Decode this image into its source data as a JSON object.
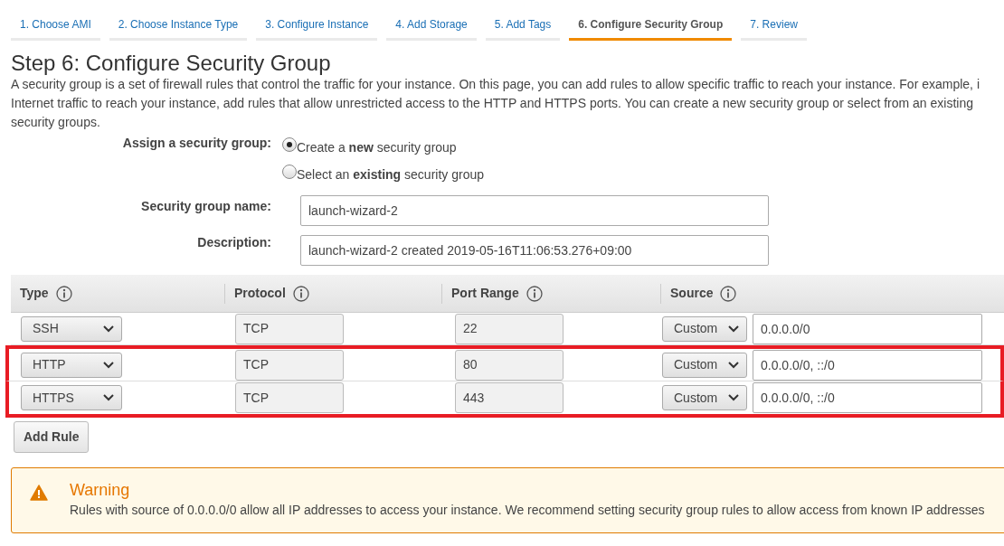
{
  "tabs": [
    {
      "label": "1. Choose AMI",
      "selected": false
    },
    {
      "label": "2. Choose Instance Type",
      "selected": false
    },
    {
      "label": "3. Configure Instance",
      "selected": false
    },
    {
      "label": "4. Add Storage",
      "selected": false
    },
    {
      "label": "5. Add Tags",
      "selected": false
    },
    {
      "label": "6. Configure Security Group",
      "selected": true
    },
    {
      "label": "7. Review",
      "selected": false
    }
  ],
  "title": "Step 6: Configure Security Group",
  "intro": "A security group is a set of firewall rules that control the traffic for your instance. On this page, you can add rules to allow specific traffic to reach your instance. For example, i",
  "intro_2": "Internet traffic to reach your instance, add rules that allow unrestricted access to the HTTP and HTTPS ports. You can create a new security group or select from an existing",
  "intro_3": "security groups.",
  "assign": {
    "label": "Assign a security group:",
    "options": [
      {
        "label": "Create a **new** security group",
        "selected": true
      },
      {
        "label": "Select an **existing** security group",
        "selected": false
      }
    ]
  },
  "fields": [
    {
      "label": "Security group name:",
      "value": "launch-wizard-2"
    },
    {
      "label": "Description:",
      "value": "launch-wizard-2 created 2019-05-16T11:06:53.276+09:00"
    }
  ],
  "table": {
    "columns": [
      "Type",
      "Protocol",
      "Port Range",
      "Source"
    ],
    "rows": [
      {
        "type": "SSH",
        "protocol": "TCP",
        "port_range": "22",
        "source": "Custom",
        "cidr": "0.0.0.0/0",
        "highlighted": false
      },
      {
        "type": "HTTP",
        "protocol": "TCP",
        "port_range": "80",
        "source": "Custom",
        "cidr": "0.0.0.0/0, ::/0",
        "highlighted": true
      },
      {
        "type": "HTTPS",
        "protocol": "TCP",
        "port_range": "443",
        "source": "Custom",
        "cidr": "0.0.0.0/0, ::/0",
        "highlighted": true
      }
    ]
  },
  "add_rule": "Add Rule",
  "warning": {
    "title": "Warning",
    "text": "Rules with source of 0.0.0.0/0 allow all IP addresses to access your instance. We recommend setting security group rules to allow access from known IP addresses"
  }
}
